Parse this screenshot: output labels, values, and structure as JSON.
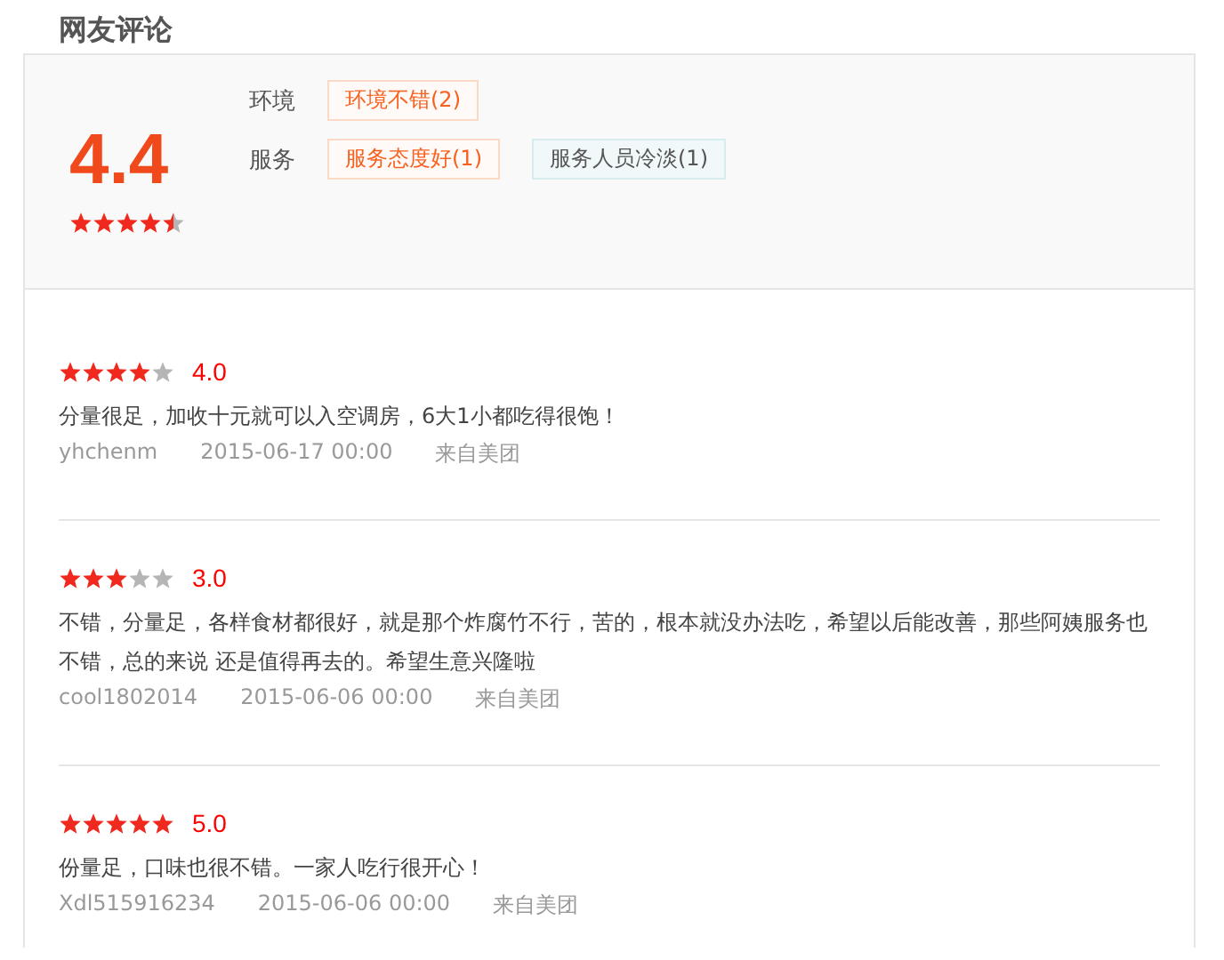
{
  "title": "网友评论",
  "summary": {
    "score": "4.4",
    "stars": 4.5,
    "categories": [
      {
        "label": "环境",
        "tags": [
          {
            "text": "环境不错(2)",
            "kind": "positive"
          }
        ]
      },
      {
        "label": "服务",
        "tags": [
          {
            "text": "服务态度好(1)",
            "kind": "positive"
          },
          {
            "text": "服务人员冷淡(1)",
            "kind": "negative"
          }
        ]
      }
    ]
  },
  "reviews": [
    {
      "stars": 4,
      "score": "4.0",
      "text": "分量很足，加收十元就可以入空调房，6大1小都吃得很饱！",
      "user": "yhchenm",
      "date": "2015-06-17 00:00",
      "source": "来自美团"
    },
    {
      "stars": 3,
      "score": "3.0",
      "text": "不错，分量足，各样食材都很好，就是那个炸腐竹不行，苦的，根本就没办法吃，希望以后能改善，那些阿姨服务也不错，总的来说 还是值得再去的。希望生意兴隆啦",
      "user": "cool1802014",
      "date": "2015-06-06 00:00",
      "source": "来自美团"
    },
    {
      "stars": 5,
      "score": "5.0",
      "text": "份量足，口味也很不错。一家人吃行很开心！",
      "user": "Xdl515916234",
      "date": "2015-06-06 00:00",
      "source": "来自美团"
    }
  ]
}
